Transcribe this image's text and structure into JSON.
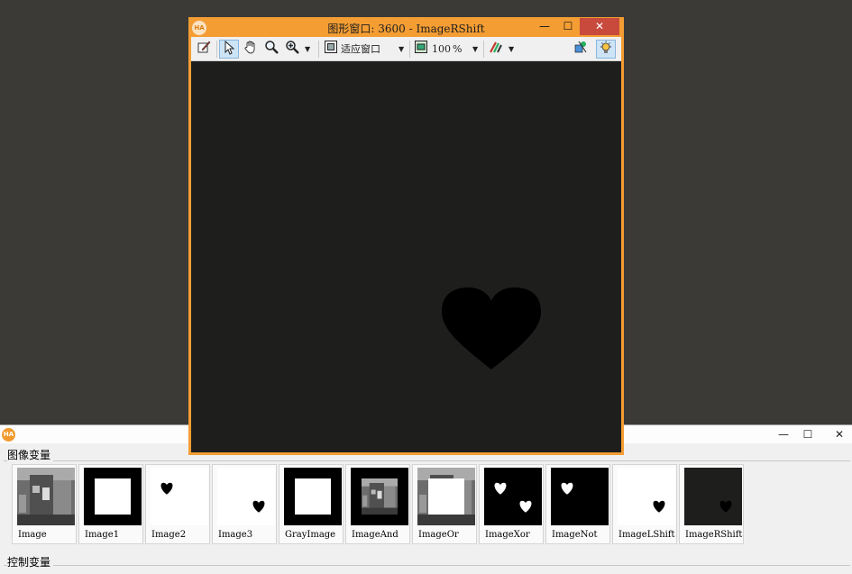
{
  "graphics_window": {
    "title": "图形窗口: 3600 - ImageRShift",
    "logo": "HA",
    "minimize": "—",
    "maximize": "☐",
    "close": "✕",
    "toolbar": {
      "fit_window_label": "适应窗口",
      "zoom_value": "100",
      "zoom_unit": "%"
    }
  },
  "variables_panel": {
    "logo": "HA",
    "minimize": "—",
    "maximize": "☐",
    "close": "✕",
    "image_section_label": "图像变量",
    "control_section_label": "控制变量",
    "images": [
      {
        "name": "Image",
        "kind": "photo"
      },
      {
        "name": "Image1",
        "kind": "square"
      },
      {
        "name": "Image2",
        "kind": "heart-topleft"
      },
      {
        "name": "Image3",
        "kind": "heart-bottomright"
      },
      {
        "name": "GrayImage",
        "kind": "square"
      },
      {
        "name": "ImageAnd",
        "kind": "photo-and"
      },
      {
        "name": "ImageOr",
        "kind": "photo-or"
      },
      {
        "name": "ImageXor",
        "kind": "xor"
      },
      {
        "name": "ImageNot",
        "kind": "not"
      },
      {
        "name": "ImageLShift",
        "kind": "lshift"
      },
      {
        "name": "ImageRShift",
        "kind": "rshift"
      }
    ]
  },
  "colors": {
    "desktop": "#3b3a36",
    "window_frame": "#f39d33",
    "canvas": "#1e1e1d",
    "heart": "#000000"
  }
}
